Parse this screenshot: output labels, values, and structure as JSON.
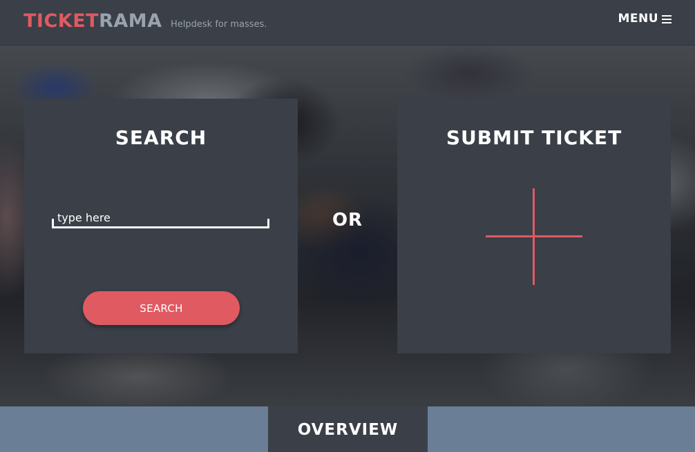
{
  "header": {
    "logo_primary": "TICKET",
    "logo_secondary": "RAMA",
    "tagline": "Helpdesk for masses.",
    "menu_label": "MENU",
    "menu_icon": "hamburger-icon"
  },
  "search_panel": {
    "title": "SEARCH",
    "input_placeholder": "type here",
    "input_value": "",
    "button_label": "SEARCH"
  },
  "divider_label": "OR",
  "submit_panel": {
    "title": "SUBMIT TICKET",
    "icon": "plus-icon"
  },
  "footer": {
    "tab_label": "OVERVIEW"
  },
  "colors": {
    "accent": "#e05a62",
    "panel": "#3a3f48",
    "footer": "#6a7f95",
    "logo_secondary": "#9aa3ad"
  }
}
